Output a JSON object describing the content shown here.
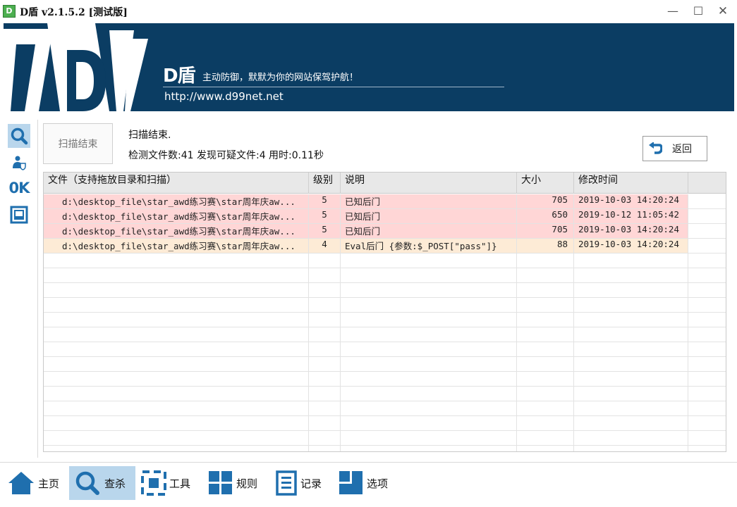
{
  "window": {
    "logo_text": "D",
    "title": "D盾 v2.1.5.2 [测试版]",
    "controls": {
      "minimize": "—",
      "maximize": "☐",
      "close": "✕"
    }
  },
  "banner": {
    "brand": "D盾",
    "slogan": "主动防御，默默为你的网站保驾护航！",
    "url": "http://www.d99net.net",
    "logo_letter": "D"
  },
  "left_nav": {
    "items": [
      {
        "name": "scan",
        "icon": "search-icon",
        "active": true
      },
      {
        "name": "user",
        "icon": "user-shield-icon",
        "active": false
      },
      {
        "name": "ok",
        "label": "0K",
        "active": false
      },
      {
        "name": "window",
        "icon": "window-icon",
        "active": false
      }
    ]
  },
  "scan": {
    "end_button": "扫描结束",
    "status": "扫描结束.",
    "stats": "检测文件数:41 发现可疑文件:4 用时:0.11秒",
    "back_button": "返回"
  },
  "table": {
    "columns": [
      "文件（支持拖放目录和扫描）",
      "级别",
      "说明",
      "大小",
      "修改时间"
    ],
    "rows": [
      {
        "file": "d:\\desktop_file\\star_awd练习赛\\star周年庆aw...",
        "level": "5",
        "description": "已知后门",
        "size": "705",
        "modified": "2019-10-03 14:20:24"
      },
      {
        "file": "d:\\desktop_file\\star_awd练习赛\\star周年庆aw...",
        "level": "5",
        "description": "已知后门",
        "size": "650",
        "modified": "2019-10-12 11:05:42"
      },
      {
        "file": "d:\\desktop_file\\star_awd练习赛\\star周年庆aw...",
        "level": "5",
        "description": "已知后门",
        "size": "705",
        "modified": "2019-10-03 14:20:24"
      },
      {
        "file": "d:\\desktop_file\\star_awd练习赛\\star周年庆aw...",
        "level": "4",
        "description": "Eval后门 {参数:$_POST[\"pass\"]}",
        "size": "88",
        "modified": "2019-10-03 14:20:24"
      }
    ],
    "colors": {
      "level5": "#ffd6d6",
      "level4": "#fdebd6"
    }
  },
  "bottom_toolbar": {
    "items": [
      {
        "label": "主页",
        "icon": "home-icon"
      },
      {
        "label": "查杀",
        "icon": "search-icon",
        "active": true
      },
      {
        "label": "工具",
        "icon": "tools-icon"
      },
      {
        "label": "规则",
        "icon": "grid-icon"
      },
      {
        "label": "记录",
        "icon": "list-icon"
      },
      {
        "label": "选项",
        "icon": "options-icon"
      }
    ]
  },
  "accent_color": "#1f6fae",
  "banner_color": "#0b3d63"
}
